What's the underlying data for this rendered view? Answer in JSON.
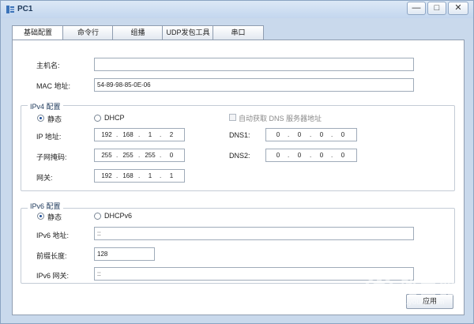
{
  "window": {
    "title": "PC1",
    "minimize": "—",
    "maximize": "□",
    "close": "✕"
  },
  "tabs": [
    {
      "label": "基础配置"
    },
    {
      "label": "命令行"
    },
    {
      "label": "组播"
    },
    {
      "label": "UDP发包工具"
    },
    {
      "label": "串口"
    }
  ],
  "basic": {
    "hostname_label": "主机名:",
    "hostname_value": "",
    "mac_label": "MAC 地址:",
    "mac_value": "54-89-98-85-0E-06"
  },
  "ipv4": {
    "group_title": "IPv4 配置",
    "static_label": "静态",
    "dhcp_label": "DHCP",
    "auto_dns_label": "自动获取 DNS 服务器地址",
    "ip_label": "IP 地址:",
    "ip": [
      "192",
      "168",
      "1",
      "2"
    ],
    "mask_label": "子网掩码:",
    "mask": [
      "255",
      "255",
      "255",
      "0"
    ],
    "gateway_label": "网关:",
    "gateway": [
      "192",
      "168",
      "1",
      "1"
    ],
    "dns1_label": "DNS1:",
    "dns1": [
      "0",
      "0",
      "0",
      "0"
    ],
    "dns2_label": "DNS2:",
    "dns2": [
      "0",
      "0",
      "0",
      "0"
    ]
  },
  "ipv6": {
    "group_title": "IPv6 配置",
    "static_label": "静态",
    "dhcp_label": "DHCPv6",
    "addr_label": "IPv6 地址:",
    "addr_value": "::",
    "prefix_label": "前缀长度:",
    "prefix_value": "128",
    "gateway_label": "IPv6 网关:",
    "gateway_value": "::"
  },
  "apply_label": "应用",
  "watermark": {
    "title": "路由器",
    "url": "luyouqi.com"
  }
}
